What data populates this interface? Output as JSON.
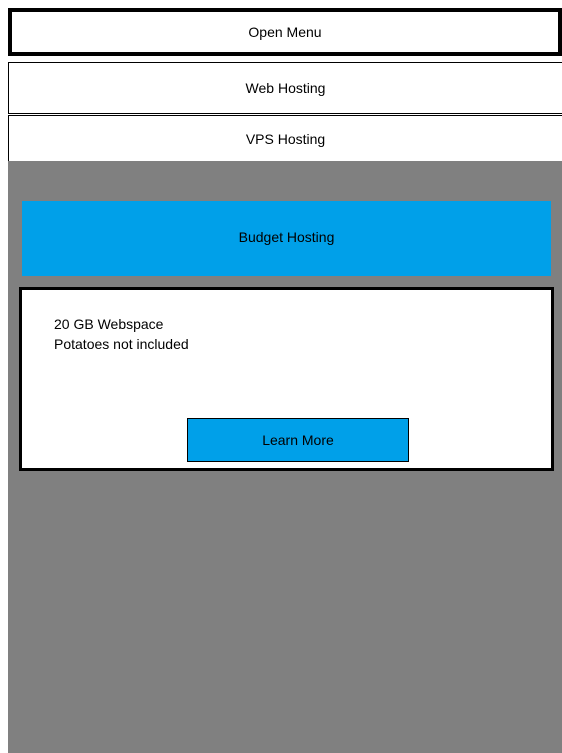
{
  "menu": {
    "open_menu_label": "Open Menu",
    "items": [
      {
        "label": "Web Hosting"
      },
      {
        "label": "VPS Hosting"
      }
    ]
  },
  "plan": {
    "title": "Budget Hosting",
    "features": [
      "20 GB Webspace",
      "Potatoes not included"
    ],
    "cta_label": "Learn More"
  },
  "colors": {
    "accent": "#00a0e9",
    "content_background": "#808080",
    "border": "#000000"
  }
}
